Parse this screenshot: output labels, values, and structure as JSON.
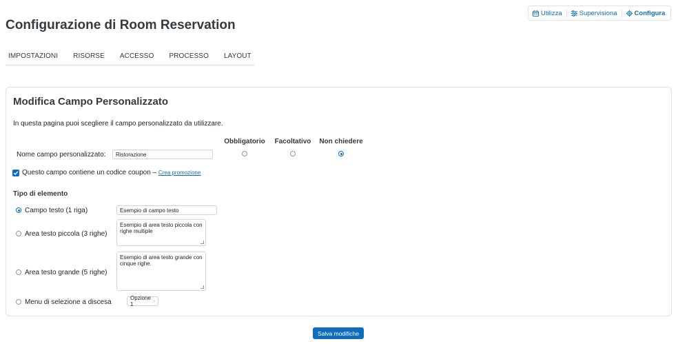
{
  "modes": {
    "items": [
      {
        "label": "Utilizza",
        "icon": "calendar-icon"
      },
      {
        "label": "Supervisiona",
        "icon": "sliders-icon"
      },
      {
        "label": "Configura",
        "icon": "gear-icon"
      }
    ],
    "active": "Configura"
  },
  "page": {
    "title": "Configurazione di Room Reservation"
  },
  "tabs": [
    {
      "label": "IMPOSTAZIONI"
    },
    {
      "label": "RISORSE"
    },
    {
      "label": "ACCESSO"
    },
    {
      "label": "PROCESSO"
    },
    {
      "label": "LAYOUT"
    }
  ],
  "form": {
    "title": "Modifica Campo Personalizzato",
    "intro": "In questa pagina puoi scegliere il campo personalizzato da utilizzare.",
    "requirement_headers": [
      "Obbligatorio",
      "Facoltativo",
      "Non chiedere"
    ],
    "requirement_selected": "Non chiedere",
    "name_label": "Nome campo personalizzato:",
    "name_value": "Ristorazione",
    "coupon": {
      "checked": true,
      "label": "Questo campo contiene un codice coupon –",
      "link": "Crea promozione"
    },
    "element_type_title": "Tipo di elemento",
    "element_types": [
      {
        "label": "Campo testo (1 riga)",
        "selected": true,
        "sample": "Esempio di campo testo"
      },
      {
        "label": "Area testo piccola (3 righe)",
        "selected": false,
        "sample": "Esempio di area testo piccola con righe multiple"
      },
      {
        "label": "Area testo grande (5 righe)",
        "selected": false,
        "sample": "Esempio di area testo grande con cinque righe."
      },
      {
        "label": "Menu di selezione a discesa",
        "selected": false,
        "sample": "Opzione 1"
      }
    ]
  },
  "save_button": "Salva modifiche",
  "colors": {
    "accent": "#0f6cbf",
    "border": "#dee2e6"
  }
}
